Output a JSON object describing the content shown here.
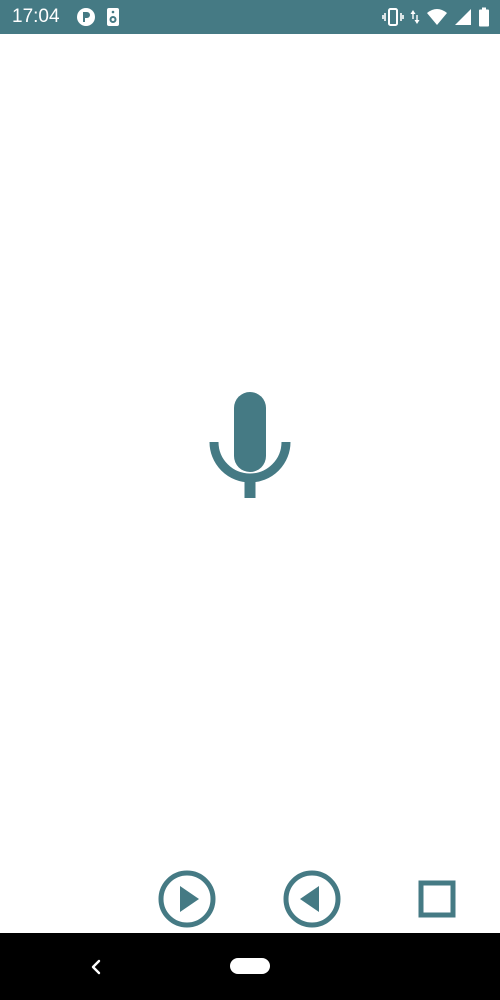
{
  "status_bar": {
    "time": "17:04",
    "left_icons": [
      "p-badge-icon",
      "speaker-icon"
    ],
    "right_icons": [
      "vibrate-icon",
      "wifi-icon",
      "signal-icon",
      "battery-icon"
    ],
    "background_color": "#457a84"
  },
  "main": {
    "icon": "microphone-icon",
    "accent_color": "#457a84"
  },
  "controls": {
    "buttons": [
      "play-button",
      "rewind-button",
      "stop-button"
    ]
  },
  "nav_bar": {
    "buttons": [
      "back-button",
      "home-button"
    ]
  }
}
